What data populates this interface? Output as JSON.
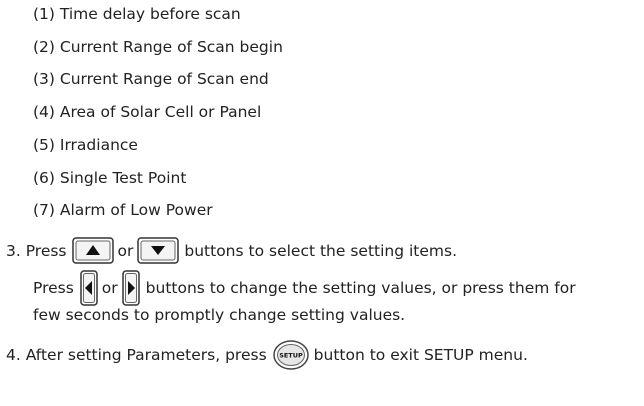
{
  "items": [
    "(1) Time delay before scan",
    "(2) Current Range of Scan begin",
    "(3) Current Range of Scan end",
    "(4) Area of Solar Cell or Panel",
    "(5) Irradiance",
    "(6) Single Test Point",
    "(7) Alarm of Low Power"
  ],
  "step3": {
    "press": "3. Press",
    "or1": "or",
    "tail1": "buttons to select the setting items.",
    "press2": "Press",
    "or2": "or",
    "tail2": "buttons to change the setting values, or press them for",
    "line3": "few seconds to promptly change setting values."
  },
  "step4": {
    "prefix": "4. After setting Parameters, press",
    "suffix": "button to exit SETUP menu.",
    "setup_label": "SETUP"
  },
  "icons": [
    "up-arrow-key-icon",
    "down-arrow-key-icon",
    "left-arrow-key-icon",
    "right-arrow-key-icon",
    "setup-key-icon"
  ]
}
